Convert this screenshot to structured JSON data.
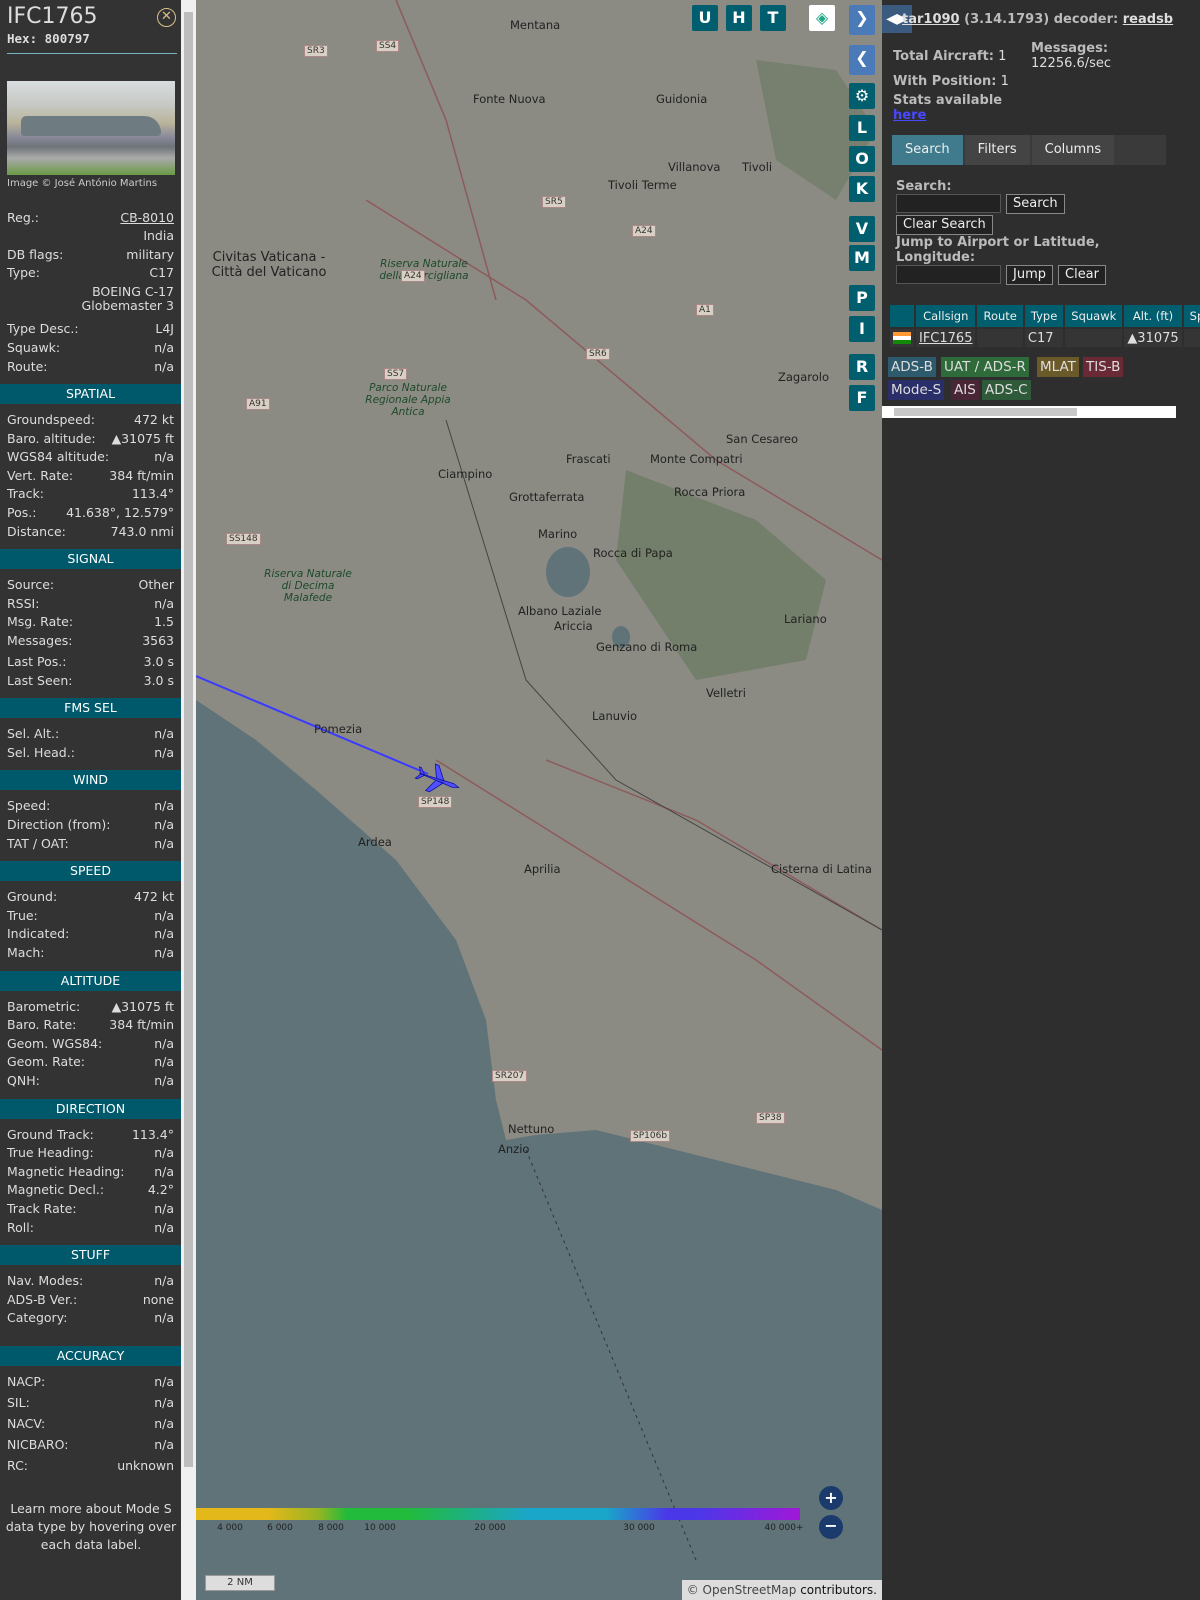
{
  "selected": {
    "callsign": "IFC1765",
    "hex_label": "Hex:",
    "hex": "800797",
    "image_credit": "Image © José António Martins",
    "fields": [
      {
        "label": "Reg.:",
        "value": "CB-8010",
        "link": true
      },
      {
        "label": "",
        "value": "India"
      },
      {
        "label": "DB flags:",
        "value": "military"
      },
      {
        "label": "Type:",
        "value": "C17"
      },
      {
        "label": "",
        "value": "BOEING C-17"
      },
      {
        "label": "",
        "value": "Globemaster 3"
      },
      {
        "label": "Type Desc.:",
        "value": "L4J"
      },
      {
        "label": "Squawk:",
        "value": "n/a"
      },
      {
        "label": "Route:",
        "value": "n/a"
      }
    ],
    "sections": [
      {
        "title": "SPATIAL",
        "rows": [
          [
            "Groundspeed:",
            "472 kt"
          ],
          [
            "Baro. altitude:",
            "▲31075 ft"
          ],
          [
            "WGS84 altitude:",
            "n/a"
          ],
          [
            "Vert. Rate:",
            "384 ft/min"
          ],
          [
            "Track:",
            "113.4°"
          ],
          [
            "Pos.:",
            "41.638°, 12.579°"
          ],
          [
            "Distance:",
            "743.0 nmi"
          ]
        ]
      },
      {
        "title": "SIGNAL",
        "rows": [
          [
            "Source:",
            "Other"
          ],
          [
            "RSSI:",
            "n/a"
          ],
          [
            "Msg. Rate:",
            "1.5"
          ],
          [
            "Messages:",
            "3563"
          ],
          [
            "Last Pos.:",
            "3.0 s"
          ],
          [
            "Last Seen:",
            "3.0 s"
          ]
        ]
      },
      {
        "title": "FMS SEL",
        "rows": [
          [
            "Sel. Alt.:",
            "n/a"
          ],
          [
            "Sel. Head.:",
            "n/a"
          ]
        ]
      },
      {
        "title": "WIND",
        "rows": [
          [
            "Speed:",
            "n/a"
          ],
          [
            "Direction (from):",
            "n/a"
          ],
          [
            "TAT / OAT:",
            "n/a"
          ]
        ]
      },
      {
        "title": "SPEED",
        "rows": [
          [
            "Ground:",
            "472 kt"
          ],
          [
            "True:",
            "n/a"
          ],
          [
            "Indicated:",
            "n/a"
          ],
          [
            "Mach:",
            "n/a"
          ]
        ]
      },
      {
        "title": "ALTITUDE",
        "rows": [
          [
            "Barometric:",
            "▲31075 ft"
          ],
          [
            "Baro. Rate:",
            "384 ft/min"
          ],
          [
            "Geom. WGS84:",
            "n/a"
          ],
          [
            "Geom. Rate:",
            "n/a"
          ],
          [
            "QNH:",
            "n/a"
          ]
        ]
      },
      {
        "title": "DIRECTION",
        "rows": [
          [
            "Ground Track:",
            "113.4°"
          ],
          [
            "True Heading:",
            "n/a"
          ],
          [
            "Magnetic Heading:",
            "n/a"
          ],
          [
            "Magnetic Decl.:",
            "4.2°"
          ],
          [
            "Track Rate:",
            "n/a"
          ],
          [
            "Roll:",
            "n/a"
          ]
        ]
      },
      {
        "title": "STUFF",
        "rows": [
          [
            "Nav. Modes:",
            "n/a"
          ],
          [
            "ADS-B Ver.:",
            "none"
          ],
          [
            "Category:",
            "n/a"
          ]
        ]
      },
      {
        "title": "ACCURACY",
        "rows": [
          [
            "NACP:",
            "n/a"
          ],
          [
            "SIL:",
            "n/a"
          ],
          [
            "NACV:",
            "n/a"
          ],
          [
            "NICBARO:",
            "n/a"
          ],
          [
            "RC:",
            "unknown"
          ]
        ]
      }
    ],
    "footer": "Learn more about Mode S data type by hovering over each data label."
  },
  "map": {
    "top_buttons": [
      "U",
      "H",
      "T"
    ],
    "side_buttons": [
      "L",
      "O",
      "K",
      "V",
      "M",
      "P",
      "I",
      "R",
      "F"
    ],
    "labels": [
      "Mentana",
      "Fonte Nuova",
      "Guidonia",
      "Villanova",
      "Tivoli",
      "Tivoli Terme",
      "Civitas Vaticana - Città del Vaticano",
      "Riserva Naturale della Marcigliana",
      "Parco Naturale Regionale Appia Antica",
      "Zagarolo",
      "San Cesareo",
      "Frascati",
      "Monte Compatri",
      "Ciampino",
      "Grottaferrata",
      "Rocca Priora",
      "Marino",
      "Rocca di Papa",
      "Riserva Naturale di Decima Malafede",
      "Albano Laziale",
      "Ariccia",
      "Genzano di Roma",
      "Lariano",
      "Velletri",
      "Lanuvio",
      "Pomezia",
      "Ardea",
      "Aprilia",
      "Cisterna di Latina",
      "Nettuno",
      "Anzio"
    ],
    "roads": [
      "SS4",
      "SR3",
      "SR5",
      "A24",
      "A24",
      "A1",
      "SR6",
      "SS7",
      "A91",
      "SS148",
      "SP148",
      "SR207",
      "SP106b",
      "SP38"
    ],
    "legend": [
      "4 000",
      "6 000",
      "8 000",
      "10 000",
      "20 000",
      "30 000",
      "40 000+"
    ],
    "scale": "2 NM",
    "attribution_prefix": "© ",
    "attribution_link": "OpenStreetMap",
    "attribution_suffix": " contributors."
  },
  "stats": {
    "app": "tar1090",
    "version": "(3.14.1793)",
    "decoder_label": "decoder:",
    "decoder": "readsb",
    "total_label": "Total Aircraft:",
    "total": "1",
    "messages_label": "Messages:",
    "messages": "12256.6/sec",
    "pos_label": "With Position:",
    "pos": "1",
    "stats_label": "Stats available",
    "stats_link": "here"
  },
  "tabs": [
    "Search",
    "Filters",
    "Columns"
  ],
  "search": {
    "label": "Search:",
    "button": "Search",
    "clear": "Clear Search",
    "jump_label": "Jump to Airport or Latitude, Longitude:",
    "jump": "Jump",
    "clear2": "Clear"
  },
  "table": {
    "headers": [
      "",
      "Callsign",
      "Route",
      "Type",
      "Squawk",
      "Alt. (ft)",
      "Spd"
    ],
    "rows": [
      {
        "callsign": "IFC1765",
        "route": "",
        "type": "C17",
        "squawk": "",
        "alt": "▲31075",
        "spd": ""
      }
    ]
  },
  "badges": [
    {
      "label": "ADS-B",
      "color": "#2e5a6e"
    },
    {
      "label": "UAT / ADS-R",
      "color": "#2f6a3a"
    },
    {
      "label": "MLAT",
      "color": "#6a5a2a"
    },
    {
      "label": "TIS-B",
      "color": "#6a2a35"
    },
    {
      "label": "Mode-S",
      "color": "#2a2f6a"
    },
    {
      "label": "AIS",
      "color": "#4a2535"
    },
    {
      "label": "ADS-C",
      "color": "#2f5a3a"
    }
  ]
}
